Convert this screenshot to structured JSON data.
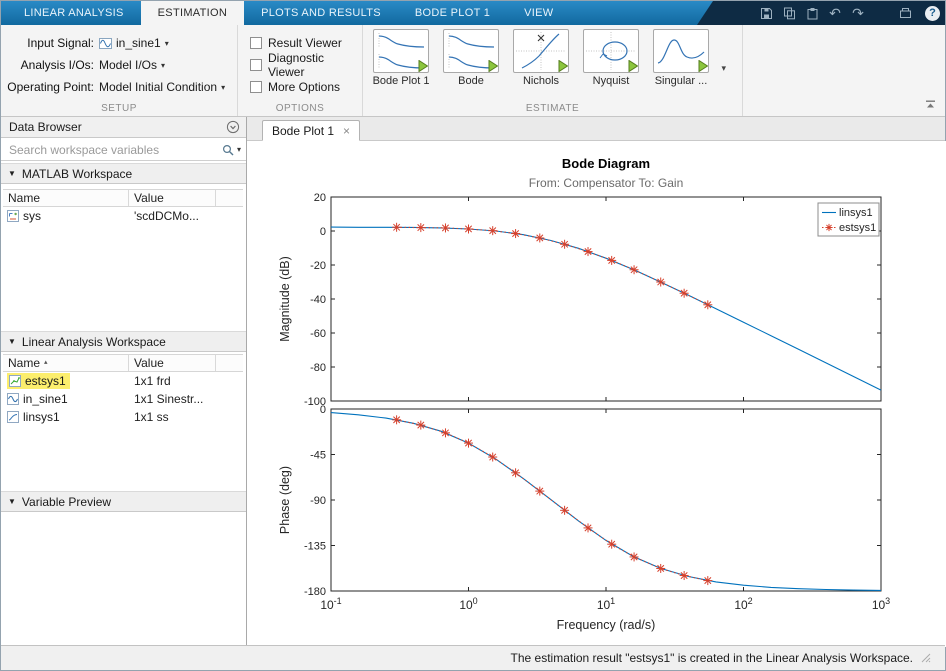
{
  "window": {
    "tabs": [
      {
        "label": "LINEAR ANALYSIS"
      },
      {
        "label": "ESTIMATION"
      },
      {
        "label": "PLOTS AND RESULTS"
      },
      {
        "label": "BODE PLOT 1"
      },
      {
        "label": "VIEW"
      }
    ]
  },
  "ribbon": {
    "setup": {
      "label": "SETUP",
      "fields": [
        {
          "label": "Input Signal:",
          "value": "in_sine1"
        },
        {
          "label": "Analysis I/Os:",
          "value": "Model I/Os"
        },
        {
          "label": "Operating Point:",
          "value": "Model Initial Condition"
        }
      ]
    },
    "options": {
      "label": "OPTIONS",
      "checkboxes": [
        "Result Viewer",
        "Diagnostic Viewer",
        "More Options"
      ]
    },
    "estimate": {
      "label": "ESTIMATE",
      "items": [
        "Bode Plot 1",
        "Bode",
        "Nichols",
        "Nyquist",
        "Singular ..."
      ]
    }
  },
  "data_browser": {
    "title": "Data Browser",
    "search_placeholder": "Search workspace variables",
    "matlab_workspace": {
      "title": "MATLAB Workspace",
      "columns": [
        "Name",
        "Value"
      ],
      "rows": [
        {
          "name": "sys",
          "value": "'scdDCMo..."
        }
      ]
    },
    "linear_workspace": {
      "title": "Linear Analysis Workspace",
      "columns": [
        "Name",
        "Value"
      ],
      "sort_column": "Name",
      "rows": [
        {
          "name": "estsys1",
          "value": "1x1 frd",
          "highlight": true
        },
        {
          "name": "in_sine1",
          "value": "1x1 Sinestr..."
        },
        {
          "name": "linsys1",
          "value": "1x1 ss"
        }
      ]
    },
    "variable_preview": {
      "title": "Variable Preview"
    }
  },
  "document": {
    "tab_label": "Bode Plot 1"
  },
  "status_bar": {
    "message": "The estimation result \"estsys1\" is created in the Linear Analysis Workspace."
  },
  "chart_data": {
    "type": "line",
    "title": "Bode Diagram",
    "subtitle": "From: Compensator  To: Gain",
    "xlabel": "Frequency  (rad/s)",
    "xscale": "log",
    "xlim": [
      0.1,
      1000
    ],
    "xticks": [
      "10^-1",
      "10^0",
      "10^1",
      "10^2",
      "10^3"
    ],
    "xtick_values": [
      0.1,
      1,
      10,
      100,
      1000
    ],
    "grid": false,
    "legend": {
      "position": "top-right",
      "entries": [
        "linsys1",
        "estsys1"
      ]
    },
    "subplots": [
      {
        "ylabel": "Magnitude (dB)",
        "ylim": [
          -100,
          20
        ],
        "yticks": [
          20,
          0,
          -20,
          -40,
          -60,
          -80,
          -100
        ],
        "series": [
          {
            "name": "linsys1",
            "color": "#0072bd",
            "style": "solid",
            "x": [
              0.1,
              0.158,
              0.251,
              0.398,
              0.631,
              1,
              1.585,
              2.512,
              3.981,
              6.31,
              10,
              15.85,
              25.12,
              39.81,
              63.1,
              100,
              158.5,
              251.2,
              398.1,
              631,
              1000
            ],
            "y": [
              2.3,
              2.2,
              2.2,
              2.1,
              1.8,
              1.2,
              0.0,
              -2.2,
              -5.6,
              -10.2,
              -16.0,
              -22.7,
              -30.1,
              -37.8,
              -45.7,
              -53.7,
              -61.6,
              -69.6,
              -77.6,
              -85.6,
              -93.6
            ]
          },
          {
            "name": "estsys1",
            "color": "#d6402c",
            "style": "dotted",
            "marker": "star",
            "x": [
              0.3,
              0.45,
              0.68,
              1.0,
              1.5,
              2.2,
              3.3,
              5.0,
              7.4,
              11,
              16,
              25,
              37,
              55
            ],
            "y": [
              2.2,
              2.0,
              1.8,
              1.2,
              0.2,
              -1.5,
              -4.1,
              -7.8,
              -12.1,
              -17.3,
              -22.8,
              -30.0,
              -36.6,
              -43.4
            ]
          }
        ]
      },
      {
        "ylabel": "Phase (deg)",
        "ylim": [
          -180,
          0
        ],
        "yticks": [
          0,
          -45,
          -90,
          -135,
          -180
        ],
        "series": [
          {
            "name": "linsys1",
            "color": "#0072bd",
            "style": "solid",
            "x": [
              0.1,
              0.158,
              0.251,
              0.398,
              0.631,
              1,
              1.585,
              2.512,
              3.981,
              6.31,
              10,
              15.85,
              25.12,
              39.81,
              63.1,
              100,
              158.5,
              251.2,
              398.1,
              631,
              1000
            ],
            "y": [
              -3.6,
              -5.7,
              -9.0,
              -14.1,
              -22.0,
              -33.7,
              -49.6,
              -68.9,
              -89.7,
              -110.7,
              -130.0,
              -146.0,
              -157.7,
              -165.7,
              -171.0,
              -174.3,
              -176.4,
              -177.7,
              -178.5,
              -179.1,
              -179.4
            ]
          },
          {
            "name": "estsys1",
            "color": "#d6402c",
            "style": "dotted",
            "marker": "star",
            "x": [
              0.3,
              0.45,
              0.68,
              1.0,
              1.5,
              2.2,
              3.3,
              5.0,
              7.4,
              11,
              16,
              25,
              37,
              55
            ],
            "y": [
              -10.7,
              -15.9,
              -23.6,
              -33.7,
              -47.5,
              -63.1,
              -81.2,
              -100.2,
              -117.6,
              -133.7,
              -146.3,
              -157.7,
              -164.7,
              -169.7
            ]
          }
        ]
      }
    ]
  }
}
